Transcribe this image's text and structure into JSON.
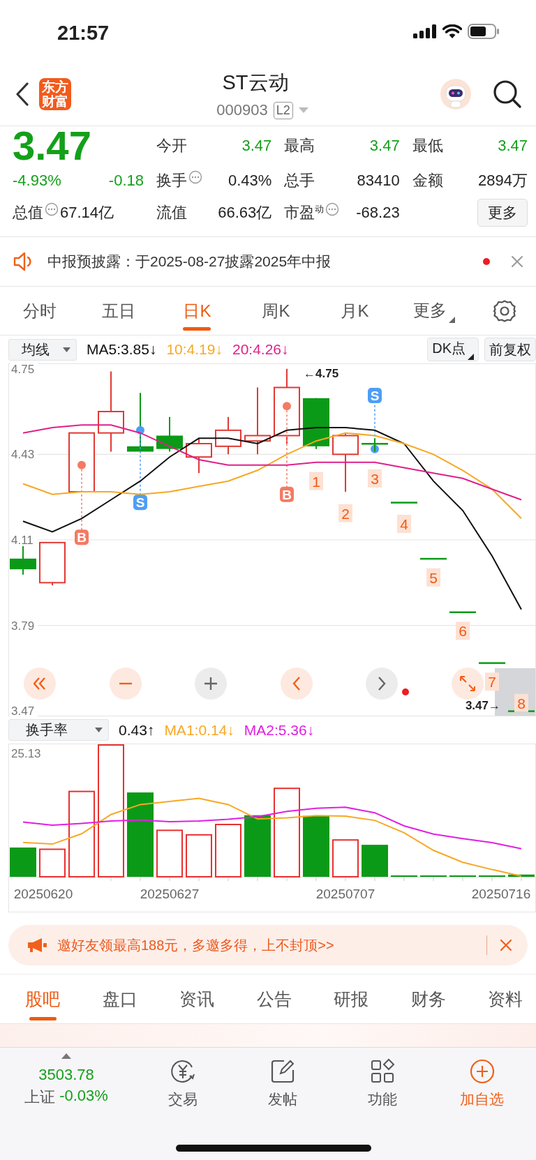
{
  "status_bar": {
    "time": "21:57"
  },
  "header": {
    "logo": "东方财富",
    "title": "ST云动",
    "code": "000903",
    "level_badge": "L2"
  },
  "quote": {
    "price": "3.47",
    "falling": true,
    "change_pct": "-4.93%",
    "change": "-0.18",
    "total_value": {
      "label": "总值",
      "value": "67.14亿",
      "info": true
    },
    "stats": [
      {
        "label": "今开",
        "value": "3.47",
        "falling": true,
        "info": false
      },
      {
        "label": "最高",
        "value": "3.47",
        "falling": true,
        "info": false
      },
      {
        "label": "最低",
        "value": "3.47",
        "falling": true,
        "info": false
      },
      {
        "label": "换手",
        "value": "0.43%",
        "falling": false,
        "info": true
      },
      {
        "label": "总手",
        "value": "83410",
        "falling": false,
        "info": false
      },
      {
        "label": "金额",
        "value": "2894万",
        "falling": false,
        "info": false
      },
      {
        "label": "流值",
        "value": "66.63亿",
        "falling": false,
        "info": false
      },
      {
        "label": "市盈$^{动}$",
        "value": "-68.23",
        "falling": false,
        "info": true
      }
    ],
    "more_button": "更多"
  },
  "notice": {
    "text": "中报预披露：于2025-08-27披露2025年中报",
    "unread": true
  },
  "period_tabs": [
    {
      "label": "分时",
      "selected": false,
      "kind": "tab"
    },
    {
      "label": "五日",
      "selected": false,
      "kind": "tab"
    },
    {
      "label": "日K",
      "selected": true,
      "kind": "tab"
    },
    {
      "label": "周K",
      "selected": false,
      "kind": "tab"
    },
    {
      "label": "月K",
      "selected": false,
      "kind": "tab"
    },
    {
      "label": "更多",
      "selected": false,
      "kind": "menu"
    }
  ],
  "indicator_bar": {
    "selector": "均线",
    "buttons": [
      {
        "label": "DK点",
        "kind": "menu"
      },
      {
        "label": "前复权",
        "kind": "plain"
      }
    ]
  },
  "kline": {
    "alert_dot": true,
    "controls": [
      {
        "kind": "rewind",
        "disabled": false
      },
      {
        "kind": "zoom-out",
        "disabled": false
      },
      {
        "kind": "zoom-in",
        "disabled": true
      },
      {
        "kind": "back",
        "disabled": false
      },
      {
        "kind": "forward",
        "disabled": true
      },
      {
        "kind": "expand",
        "disabled": false
      }
    ],
    "chart_data": {
      "type": "line",
      "grid": true,
      "ylim": [
        3.45,
        4.77
      ],
      "yticks": [
        3.47,
        3.79,
        4.11,
        4.43,
        4.75
      ],
      "categories": [
        null,
        null,
        null,
        null,
        null,
        null,
        null,
        null,
        null,
        null,
        null,
        null,
        null,
        null,
        null,
        null,
        null,
        null
      ],
      "series": [
        {
          "name": "MA5:3.85↓",
          "color": "#111111",
          "values": [
            4.18,
            4.14,
            4.19,
            4.26,
            4.33,
            4.42,
            4.49,
            4.49,
            4.47,
            4.52,
            4.53,
            4.53,
            4.52,
            4.47,
            4.33,
            4.22,
            4.05,
            3.85
          ]
        },
        {
          "name": "10:4.19↓",
          "color": "#f7a823",
          "values": [
            4.32,
            4.28,
            4.29,
            4.29,
            4.28,
            4.29,
            4.31,
            4.33,
            4.37,
            4.43,
            4.48,
            4.51,
            4.5,
            4.47,
            4.43,
            4.37,
            4.3,
            4.19
          ]
        },
        {
          "name": "20:4.26↓",
          "color": "#e0208a",
          "values": [
            4.51,
            4.53,
            4.54,
            4.54,
            4.51,
            4.46,
            4.41,
            4.39,
            4.39,
            4.39,
            4.4,
            4.4,
            4.4,
            4.38,
            4.36,
            4.34,
            4.3,
            4.26
          ]
        }
      ]
    },
    "markers": [
      {
        "kind": "buy",
        "text": "B"
      },
      {
        "kind": "sell",
        "text": "S"
      },
      {
        "kind": "buy",
        "text": "B"
      },
      {
        "kind": "high",
        "text": "←4.75"
      },
      {
        "kind": "count",
        "text": "1"
      },
      {
        "kind": "count",
        "text": "2"
      },
      {
        "kind": "sell",
        "text": "S"
      },
      {
        "kind": "count",
        "text": "3"
      },
      {
        "kind": "count",
        "text": "4"
      },
      {
        "kind": "count",
        "text": "5"
      },
      {
        "kind": "count",
        "text": "6"
      },
      {
        "kind": "count",
        "text": "7"
      },
      {
        "kind": "last",
        "text": "3.47→"
      },
      {
        "kind": "count",
        "text": "8"
      }
    ]
  },
  "turnover": {
    "selector": "换手率",
    "legend": [
      {
        "text": "0.43↑",
        "color": "#111111"
      },
      {
        "text": "MA1:0.14↓",
        "color": "#f7a823"
      },
      {
        "text": "MA2:5.36↓",
        "color": "#e020e0"
      }
    ],
    "scale_label": "25.13",
    "dates": [
      "20250620",
      "20250627",
      "20250707",
      "20250716"
    ]
  },
  "promo": {
    "text": "邀好友领最高188元，多邀多得，上不封顶>>"
  },
  "content_tabs": [
    {
      "label": "股吧",
      "selected": true
    },
    {
      "label": "盘口",
      "selected": false
    },
    {
      "label": "资讯",
      "selected": false
    },
    {
      "label": "公告",
      "selected": false
    },
    {
      "label": "研报",
      "selected": false
    },
    {
      "label": "财务",
      "selected": false
    },
    {
      "label": "资料",
      "selected": false
    }
  ],
  "bottom_bar": {
    "index": {
      "value": "3503.78",
      "name": "上证",
      "change": "-0.03%",
      "falling": true
    },
    "actions": [
      {
        "label": "交易",
        "kind": "trade",
        "highlight": false
      },
      {
        "label": "发帖",
        "kind": "post",
        "highlight": false
      },
      {
        "label": "功能",
        "kind": "apps",
        "highlight": false
      },
      {
        "label": "加自选",
        "kind": "add",
        "highlight": true
      }
    ]
  }
}
